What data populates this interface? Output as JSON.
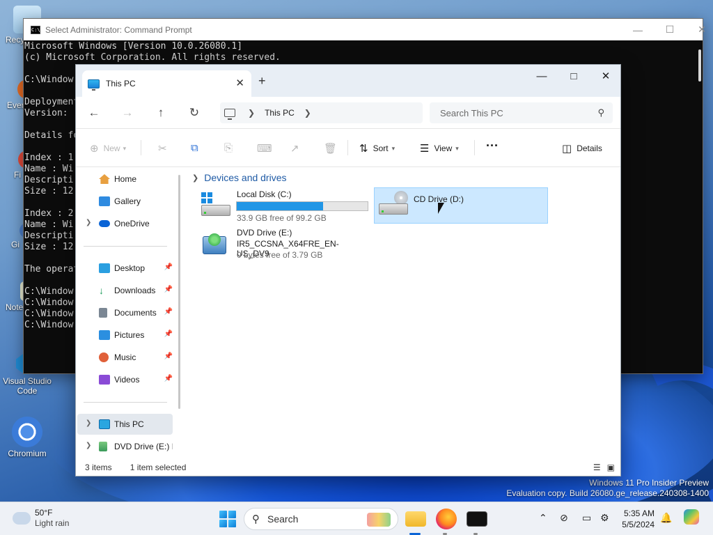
{
  "desktop": {
    "icons": [
      {
        "label": "Recy",
        "icon": "recycle-bin-icon"
      },
      {
        "label": "Ever",
        "icon": "everything-icon"
      },
      {
        "label": "Fi",
        "icon": "app-icon"
      },
      {
        "label": "Gi",
        "icon": "git-icon"
      },
      {
        "label": "Note",
        "icon": "notepad-icon"
      },
      {
        "label": "Visual Studio Code",
        "icon": "vscode-icon"
      },
      {
        "label": "Chromium",
        "icon": "chromium-icon"
      }
    ],
    "watermark": {
      "line1": "Windows 11 Pro Insider Preview",
      "line2": "Evaluation copy. Build 26080.ge_release.240308-1400"
    }
  },
  "cmd": {
    "title": "Select Administrator: Command Prompt",
    "lines": [
      "Microsoft Windows [Version 10.0.26080.1]",
      "(c) Microsoft Corporation. All rights reserved.",
      "",
      "C:\\Window",
      "",
      "Deployment",
      "Version: ",
      "",
      "Details fo",
      "",
      "Index : 1",
      "Name : Wi",
      "Descripti",
      "Size : 12",
      "",
      "Index : 2",
      "Name : Wi",
      "Descripti",
      "Size : 12",
      "",
      "The operat",
      "",
      "C:\\Window",
      "C:\\Window",
      "C:\\Window",
      "C:\\Window"
    ]
  },
  "explorer": {
    "tab": {
      "title": "This PC"
    },
    "breadcrumb": {
      "location": "This PC"
    },
    "search": {
      "placeholder": "Search This PC"
    },
    "toolbar": {
      "new_label": "New",
      "sort_label": "Sort",
      "view_label": "View",
      "more_label": "···",
      "details_label": "Details"
    },
    "nav": {
      "top": [
        {
          "label": "Home",
          "icon": "home-icon",
          "color": "#e8a040"
        },
        {
          "label": "Gallery",
          "icon": "gallery-icon",
          "color": "#2f8be0"
        },
        {
          "label": "OneDrive",
          "icon": "onedrive-icon",
          "color": "#0a64d6"
        }
      ],
      "pinned": [
        {
          "label": "Desktop",
          "icon": "desktop-folder-icon",
          "color": "#2a9fe0"
        },
        {
          "label": "Downloads",
          "icon": "downloads-icon",
          "color": "#1b9b5a"
        },
        {
          "label": "Documents",
          "icon": "documents-icon",
          "color": "#7b8794"
        },
        {
          "label": "Pictures",
          "icon": "pictures-icon",
          "color": "#2b8fe0"
        },
        {
          "label": "Music",
          "icon": "music-icon",
          "color": "#e0603a"
        },
        {
          "label": "Videos",
          "icon": "videos-icon",
          "color": "#8a4bd6"
        }
      ],
      "bottom": [
        {
          "label": "This PC",
          "icon": "this-pc-icon",
          "color": "#2aa6e0"
        },
        {
          "label": "DVD Drive (E:) IR",
          "icon": "dvd-drive-icon",
          "color": "#3a9a5a"
        }
      ]
    },
    "group": {
      "title": "Devices and drives"
    },
    "drives": [
      {
        "name": "Local Disk (C:)",
        "detail": "33.9 GB free of 99.2 GB",
        "used_fraction": 0.658
      },
      {
        "name": "CD Drive (D:)"
      },
      {
        "name": "DVD Drive (E:)",
        "label2": "IR5_CCSNA_X64FRE_EN-US_DV9",
        "detail": "0 bytes free of 3.79 GB"
      }
    ],
    "status": {
      "items": "3 items",
      "selected": "1 item selected"
    }
  },
  "taskbar": {
    "weather": {
      "temp": "50°F",
      "condition": "Light rain"
    },
    "search_label": "Search",
    "clock": {
      "time": "5:35 AM",
      "date": "5/5/2024"
    }
  }
}
